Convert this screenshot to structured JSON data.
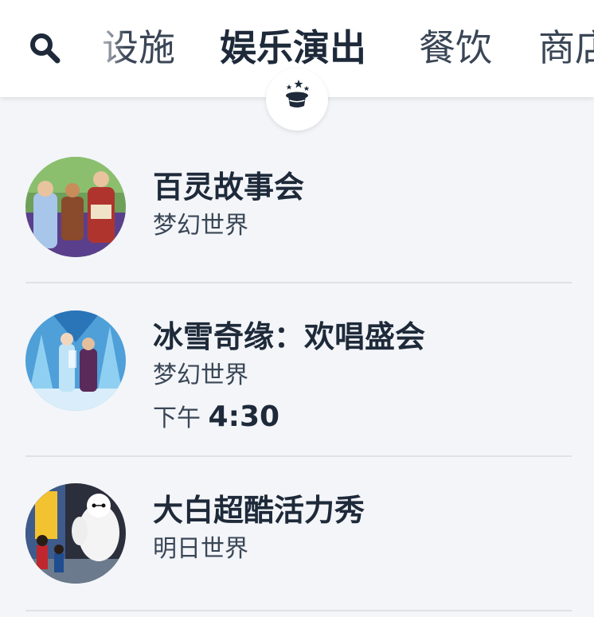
{
  "tabs": [
    {
      "label": "设施"
    },
    {
      "label": "娱乐演出"
    },
    {
      "label": "餐饮"
    },
    {
      "label": "商店"
    }
  ],
  "active_tab_index": 1,
  "category_icon": "magic-hat-icon",
  "shows": [
    {
      "title": "百灵故事会",
      "land": "梦幻世界",
      "time_prefix": "",
      "time_value": ""
    },
    {
      "title": "冰雪奇缘：欢唱盛会",
      "land": "梦幻世界",
      "time_prefix": "下午",
      "time_value": "4:30"
    },
    {
      "title": "大白超酷活力秀",
      "land": "明日世界",
      "time_prefix": "",
      "time_value": ""
    }
  ],
  "colors": {
    "text_primary": "#1e2a3a",
    "text_secondary": "#3a4656",
    "background": "#f3f5f8",
    "divider": "#dde2e8"
  }
}
